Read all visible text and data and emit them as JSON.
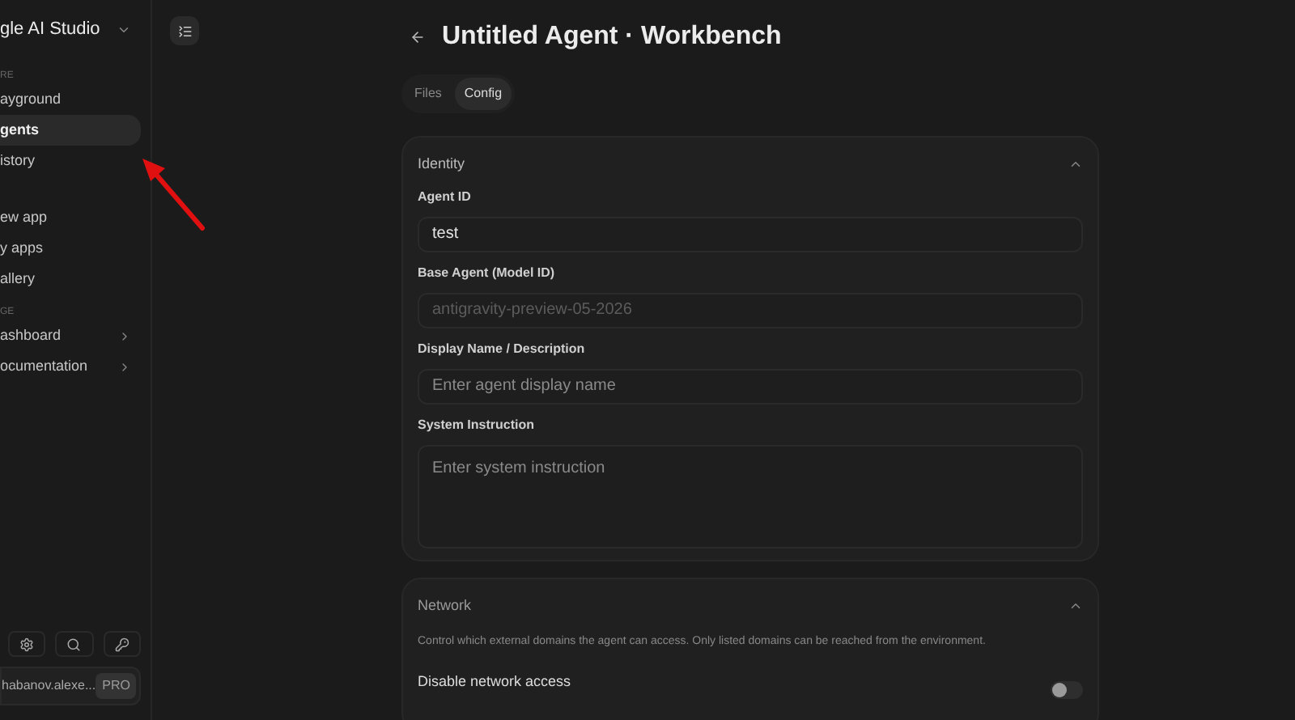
{
  "sidebar": {
    "brand": "gle AI Studio",
    "sections": [
      {
        "label": "RE",
        "items": [
          {
            "label": "ayground",
            "selected": false,
            "chevron": false
          },
          {
            "label": "gents",
            "selected": true,
            "chevron": false
          },
          {
            "label": "istory",
            "selected": false,
            "chevron": false
          }
        ]
      },
      {
        "items": [
          {
            "label": "ew app",
            "selected": false,
            "chevron": false
          },
          {
            "label": "y apps",
            "selected": false,
            "chevron": false
          },
          {
            "label": "allery",
            "selected": false,
            "chevron": false
          }
        ]
      },
      {
        "label": "GE",
        "items": [
          {
            "label": "ashboard",
            "selected": false,
            "chevron": true
          },
          {
            "label": "ocumentation",
            "selected": false,
            "chevron": true
          }
        ]
      }
    ],
    "user": {
      "name": "habanov.alexe...",
      "badge": "PRO"
    }
  },
  "header": {
    "title": "Untitled Agent · Workbench"
  },
  "tabs": [
    {
      "label": "Files",
      "selected": false
    },
    {
      "label": "Config",
      "selected": true
    }
  ],
  "identity": {
    "title": "Identity",
    "expanded": true,
    "fields": [
      {
        "kind": "input",
        "label": "Agent ID",
        "value": "test"
      },
      {
        "kind": "readonly",
        "label": "Base Agent (Model ID)",
        "value": "antigravity-preview-05-2026"
      },
      {
        "kind": "input",
        "label": "Display Name / Description",
        "placeholder": "Enter agent display name"
      },
      {
        "kind": "textarea",
        "label": "System Instruction",
        "placeholder": "Enter system instruction"
      }
    ]
  },
  "network": {
    "title": "Network",
    "expanded": true,
    "description": "Control which external domains the agent can access. Only listed domains can be reached from the environment.",
    "toggle_label": "Disable network access",
    "on": false
  }
}
